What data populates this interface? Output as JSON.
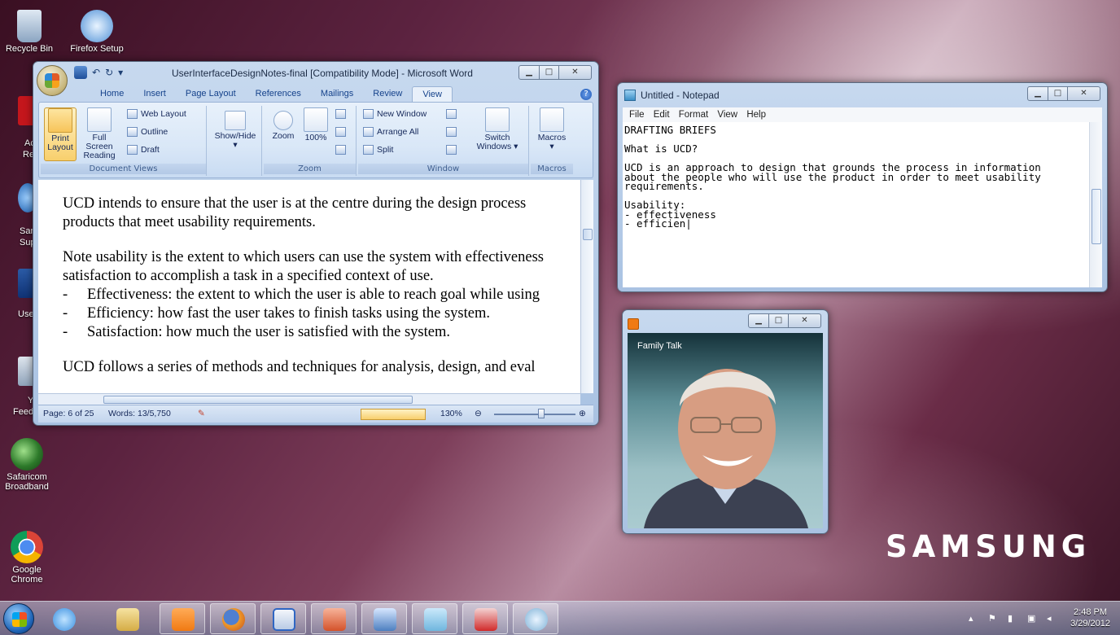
{
  "desktop": {
    "icons": [
      {
        "label": "Recycle Bin",
        "color": "#9ab8d8"
      },
      {
        "label": "Firefox Setup",
        "color": "#7cb6e8"
      },
      {
        "label": "Safaricom Broadband",
        "color": "#3d7d3a"
      },
      {
        "label": "Google Chrome",
        "color": "#e24b3b"
      }
    ],
    "partial_labels": [
      "Ac",
      "Rea",
      "San",
      "Sup",
      "User",
      "Y",
      "Feed"
    ]
  },
  "word": {
    "title": "UserInterfaceDesignNotes-final [Compatibility Mode] - Microsoft Word",
    "tabs": [
      "Home",
      "Insert",
      "Page Layout",
      "References",
      "Mailings",
      "Review",
      "View"
    ],
    "active_tab": "View",
    "ribbon": {
      "document_views": {
        "label": "Document Views",
        "print_layout": "Print Layout",
        "full_screen_reading": "Full Screen Reading",
        "web_layout": "Web Layout",
        "outline": "Outline",
        "draft": "Draft"
      },
      "show_hide": {
        "label": "Show/Hide"
      },
      "zoom": {
        "label": "Zoom",
        "zoom": "Zoom",
        "hundred": "100%"
      },
      "window": {
        "label": "Window",
        "new_window": "New Window",
        "arrange_all": "Arrange All",
        "split": "Split",
        "switch_windows": "Switch Windows"
      },
      "macros": {
        "label": "Macros",
        "macros": "Macros"
      }
    },
    "document": {
      "para1_line1": "UCD intends to ensure that the user is at the centre during the design process",
      "para1_line2": "products that meet usability requirements.",
      "para2_line1": "Note usability is the extent to which users can use the system with effectiveness",
      "para2_line2": "satisfaction to accomplish a task in a specified context of use.",
      "bullets": [
        "Effectiveness: the extent to which the user is able to reach goal while using",
        "Efficiency: how fast the user takes to finish tasks using the system.",
        "Satisfaction: how much the user is satisfied with the system."
      ],
      "para3_line1": "UCD follows a series of methods and techniques for analysis, design, and eval"
    },
    "status": {
      "page": "Page: 6 of 25",
      "words": "Words: 13/5,750",
      "zoom": "130%"
    }
  },
  "notepad": {
    "title": "Untitled - Notepad",
    "menu": [
      "File",
      "Edit",
      "Format",
      "View",
      "Help"
    ],
    "content": "DRAFTING BRIEFS\n\nWhat is UCD?\n\nUCD is an approach to design that grounds the process in information\nabout the people who will use the product in order to meet usability\nrequirements.\n\nUsability:\n- effectiveness\n- efficien|"
  },
  "family_talk": {
    "label": "Family Talk"
  },
  "brand": {
    "logo": "SAMSUNG"
  },
  "taskbar": {
    "time": "2:48 PM",
    "date": "3/29/2012",
    "apps": [
      {
        "name": "internet-explorer",
        "color": "#3a8fe0"
      },
      {
        "name": "file-explorer",
        "color": "#e8c766"
      },
      {
        "name": "family-talk",
        "color": "#f07a13"
      },
      {
        "name": "firefox",
        "color": "#e0731f"
      },
      {
        "name": "word",
        "color": "#2f66c3"
      },
      {
        "name": "powerpoint",
        "color": "#d4522a"
      },
      {
        "name": "app-blue",
        "color": "#4d7fc0"
      },
      {
        "name": "notepad",
        "color": "#6fb6de"
      },
      {
        "name": "acrobat",
        "color": "#d12a2a"
      },
      {
        "name": "paint",
        "color": "#7fb2d6"
      }
    ]
  }
}
